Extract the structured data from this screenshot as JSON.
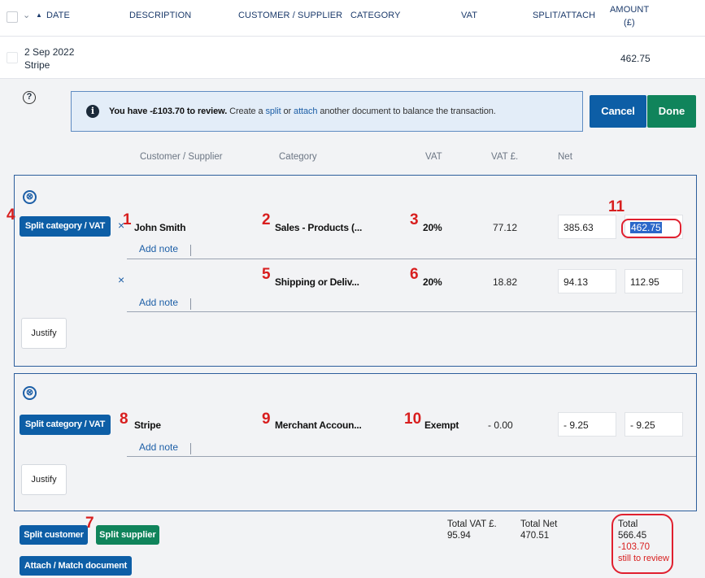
{
  "header": {
    "date": "DATE",
    "description": "DESCRIPTION",
    "customer_supplier": "CUSTOMER / SUPPLIER",
    "category": "CATEGORY",
    "vat": "VAT",
    "split_attach": "SPLIT/ATTACH",
    "amount": "AMOUNT",
    "amount_unit": "(£)"
  },
  "transaction": {
    "date": "2 Sep 2022",
    "description": "Stripe",
    "amount": "462.75"
  },
  "review": {
    "help_icon": "?",
    "bold": "You have -£103.70 to review.",
    "text1": " Create a ",
    "link1": "split",
    "text2": " or ",
    "link2": "attach",
    "text3": " another document to balance the transaction.",
    "cancel": "Cancel",
    "done": "Done"
  },
  "columns": {
    "customer_supplier": "Customer / Supplier",
    "category": "Category",
    "vat": "VAT",
    "vat_amount": "VAT £.",
    "net": "Net"
  },
  "group1": {
    "split_label": "Split category / VAT",
    "justify": "Justify",
    "lines": [
      {
        "customer": "John Smith",
        "category": "Sales - Products (...",
        "vat_rate": "20%",
        "vat_amount": "77.12",
        "net": "385.63",
        "gross": "462.75",
        "note": "Add note"
      },
      {
        "customer": "",
        "category": "Shipping or Deliv...",
        "vat_rate": "20%",
        "vat_amount": "18.82",
        "net": "94.13",
        "gross": "112.95",
        "note": "Add note"
      }
    ]
  },
  "group2": {
    "split_label": "Split category / VAT",
    "justify": "Justify",
    "lines": [
      {
        "customer": "Stripe",
        "category": "Merchant Accoun...",
        "vat_rate": "Exempt",
        "vat_amount": "- 0.00",
        "net": "- 9.25",
        "gross": "- 9.25",
        "note": "Add note"
      }
    ]
  },
  "annotations": [
    "1",
    "2",
    "3",
    "4",
    "5",
    "6",
    "7",
    "8",
    "9",
    "10",
    "11"
  ],
  "footer": {
    "split_customer": "Split customer",
    "split_supplier": "Split supplier",
    "attach": "Attach / Match document",
    "total_vat_label": "Total VAT £.",
    "total_vat": "95.94",
    "total_net_label": "Total Net",
    "total_net": "470.51",
    "total_label": "Total",
    "total": "566.45",
    "remaining": "-103.70",
    "remaining_label": "still to review"
  },
  "icons": {
    "remove": "×",
    "close_circle": "⊗",
    "info": "i",
    "sort": "▲",
    "chevron": "⌄"
  },
  "colors": {
    "primary": "#0d5ea6",
    "success": "#10845b",
    "annotation": "#d81e1e"
  }
}
